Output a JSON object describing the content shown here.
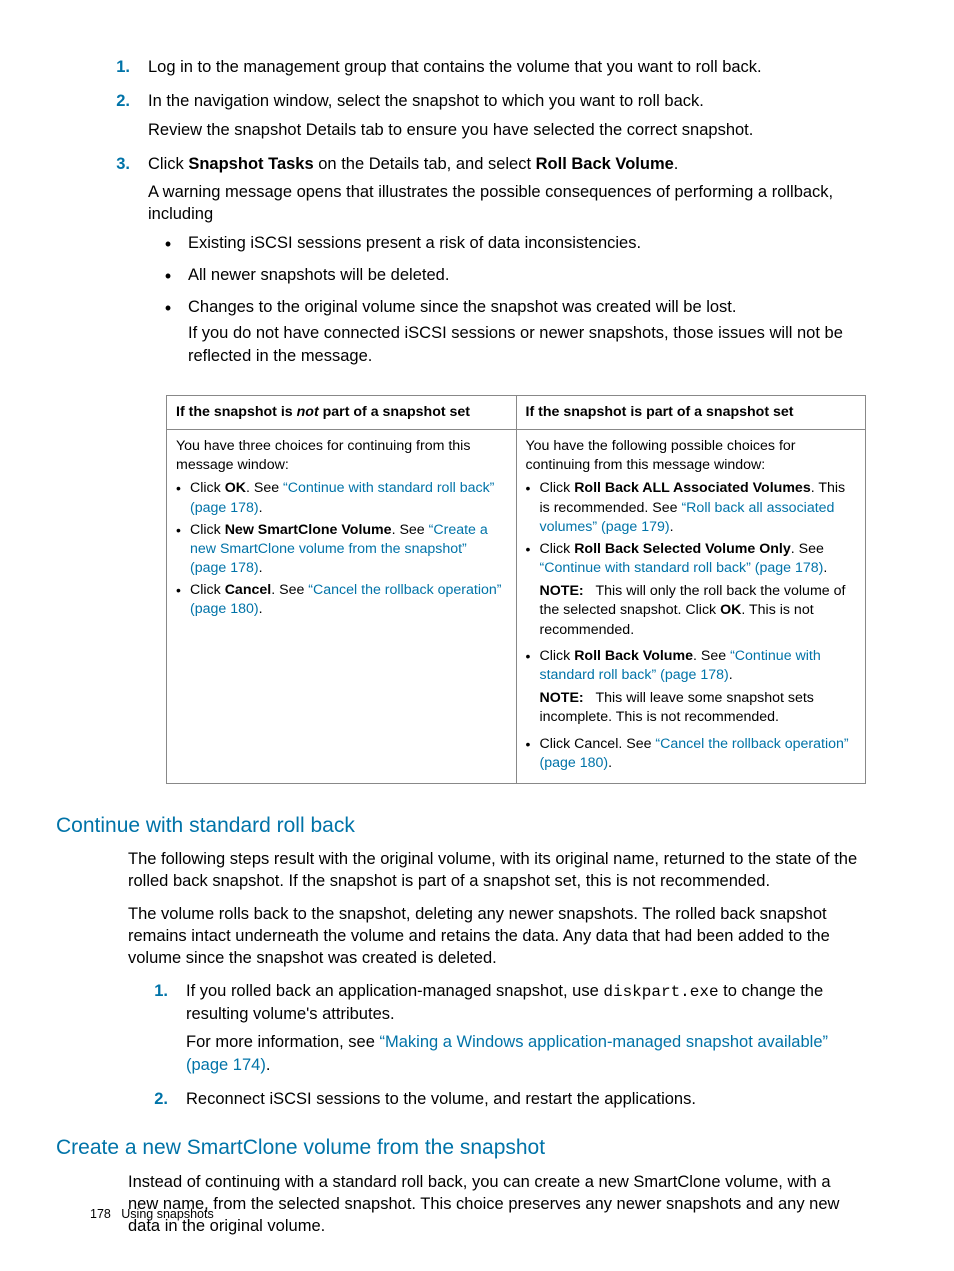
{
  "steps": {
    "s1": {
      "num": "1.",
      "text": "Log in to the management group that contains the volume that you want to roll back."
    },
    "s2": {
      "num": "2.",
      "p1": "In the navigation window, select the snapshot to which you want to roll back.",
      "p2": "Review the snapshot Details tab to ensure you have selected the correct snapshot."
    },
    "s3": {
      "num": "3.",
      "p1_a": "Click ",
      "p1_b": "Snapshot Tasks",
      "p1_c": " on the Details tab, and select ",
      "p1_d": "Roll Back Volume",
      "p1_e": ".",
      "p2": "A warning message opens that illustrates the possible consequences of performing a rollback, including",
      "b1": "Existing iSCSI sessions present a risk of data inconsistencies.",
      "b2": "All newer snapshots will be deleted.",
      "b3": "Changes to the original volume since the snapshot was created will be lost.",
      "b3p": "If you do not have connected iSCSI sessions or newer snapshots, those issues will not be reflected in the message."
    }
  },
  "table": {
    "h1_a": "If the snapshot is ",
    "h1_b": "not",
    "h1_c": " part of a snapshot set",
    "h2": "If the snapshot is part of a snapshot set",
    "left": {
      "intro": "You have three choices for continuing from this message window:",
      "i1a": "Click ",
      "i1b": "OK",
      "i1c": ". See ",
      "i1link": "“Continue with standard roll back” (page 178)",
      "i1d": ".",
      "i2a": "Click ",
      "i2b": "New SmartClone Volume",
      "i2c": ". See ",
      "i2link": "“Create a new SmartClone volume from the snapshot” (page 178)",
      "i2d": ".",
      "i3a": "Click ",
      "i3b": "Cancel",
      "i3c": ". See ",
      "i3link": "“Cancel the rollback operation” (page 180)",
      "i3d": "."
    },
    "right": {
      "intro": "You have the following possible choices for continuing from this message window:",
      "i1a": "Click ",
      "i1b": "Roll Back ALL Associated Volumes",
      "i1c": ". This is recommended. See ",
      "i1link": "“Roll back all associated volumes” (page 179)",
      "i1d": ".",
      "i2a": "Click ",
      "i2b": "Roll Back Selected Volume Only",
      "i2c": ". See ",
      "i2link": "“Continue with standard roll back” (page 178)",
      "i2d": ".",
      "n1lbl": "NOTE:",
      "n1a": "   This will only the roll back the volume of the selected snapshot. Click ",
      "n1b": "OK",
      "n1c": ". This is not recommended.",
      "i3a": "Click ",
      "i3b": "Roll Back Volume",
      "i3c": ". See ",
      "i3link": "“Continue with standard roll back” (page 178)",
      "i3d": ".",
      "n2lbl": "NOTE:",
      "n2": "   This will leave some snapshot sets incomplete. This is not recommended.",
      "i4a": "Click Cancel. See ",
      "i4link": "“Cancel the rollback operation” (page 180)",
      "i4d": "."
    }
  },
  "sec1": {
    "title": "Continue with standard roll back",
    "p1": "The following steps result with the original volume, with its original name, returned to the state of the rolled back snapshot. If the snapshot is part of a snapshot set, this is not recommended.",
    "p2": "The volume rolls back to the snapshot, deleting any newer snapshots. The rolled back snapshot remains intact underneath the volume and retains the data. Any data that had been added to the volume since the snapshot was created is deleted.",
    "s1num": "1.",
    "s1a": "If you rolled back an application-managed snapshot, use ",
    "s1code": "diskpart.exe",
    "s1b": " to change the resulting volume's attributes.",
    "s1c": "For more information, see ",
    "s1link": "“Making a Windows application-managed snapshot available” (page 174)",
    "s1d": ".",
    "s2num": "2.",
    "s2": "Reconnect iSCSI sessions to the volume, and restart the applications."
  },
  "sec2": {
    "title": "Create a new SmartClone volume from the snapshot",
    "p1": "Instead of continuing with a standard roll back, you can create a new SmartClone volume, with a new name, from the selected snapshot. This choice preserves any newer snapshots and any new data in the original volume."
  },
  "footer": {
    "page": "178",
    "label": "Using snapshots"
  }
}
